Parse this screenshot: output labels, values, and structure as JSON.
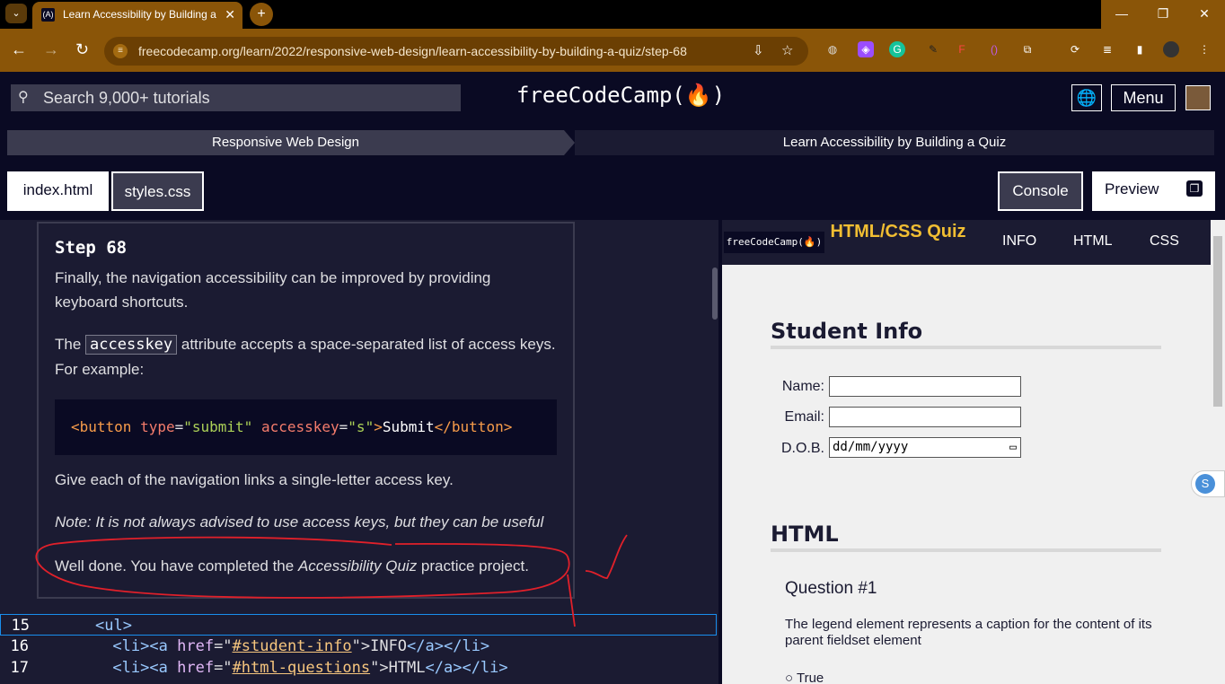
{
  "browser": {
    "tab_title": "Learn Accessibility by Building a",
    "tab_close": "✕",
    "new_tab": "+",
    "tab_favicon": "(A)",
    "url": "freecodecamp.org/learn/2022/responsive-web-design/learn-accessibility-by-building-a-quiz/step-68",
    "window_controls": {
      "minimize": "—",
      "restore": "❐",
      "close": "✕"
    },
    "back": "←",
    "forward": "→",
    "reload": "↻"
  },
  "fcc_nav": {
    "search_placeholder": "Search 9,000+ tutorials",
    "logo": "freeCodeCamp(🔥)",
    "menu_label": "Menu",
    "globe": "🌐"
  },
  "breadcrumb": {
    "superblock": "Responsive Web Design",
    "block": "Learn Accessibility by Building a Quiz"
  },
  "editor_tabs": [
    {
      "label": "index.html",
      "active": false
    },
    {
      "label": "styles.css",
      "active": true
    }
  ],
  "right_buttons": {
    "console": "Console",
    "preview": "Preview"
  },
  "instructions": {
    "step_title": "Step 68",
    "p1": "Finally, the navigation accessibility can be improved by providing keyboard shortcuts.",
    "p2_before": "The ",
    "p2_code": "accesskey",
    "p2_after": " attribute accepts a space-separated list of access keys. For example:",
    "example": {
      "open": "<",
      "tag": "button",
      "attr1": "type",
      "val1": "\"submit\"",
      "attr2": "accesskey",
      "val2": "\"s\"",
      "text": "Submit",
      "close_tag": "button",
      "eq": "=",
      "gt": ">",
      "closing_open": "</"
    },
    "p3": "Give each of the navigation links a single-letter access key.",
    "note": "Note: It is not always advised to use access keys, but they can be useful",
    "done_before": "Well done. You have completed the ",
    "done_em": "Accessibility Quiz",
    "done_after": " practice project."
  },
  "code_lines": [
    {
      "num": "15",
      "indent": "    ",
      "open": "<",
      "tag": "ul",
      "close": ">"
    },
    {
      "num": "16",
      "indent": "      ",
      "li_open": "<li><",
      "a": "a",
      "href": "href",
      "eq": "=\"",
      "link": "#student-info",
      "endq": "\">",
      "text": "INFO",
      "tail": "</a></li>"
    },
    {
      "num": "17",
      "indent": "      ",
      "li_open": "<li><",
      "a": "a",
      "href": "href",
      "eq": "=\"",
      "link": "#html-questions",
      "endq": "\">",
      "text": "HTML",
      "tail": "</a></li>"
    }
  ],
  "preview": {
    "logo": "freeCodeCamp(🔥)",
    "title": "HTML/CSS Quiz",
    "nav": [
      "INFO",
      "HTML",
      "CSS"
    ],
    "section1": "Student Info",
    "fields": [
      {
        "label": "Name:",
        "value": ""
      },
      {
        "label": "Email:",
        "value": ""
      },
      {
        "label": "D.O.B.",
        "value": "dd/mm/yyyy"
      }
    ],
    "section2": "HTML",
    "question": "Question #1",
    "question_text": "The legend element represents a caption for the content of its parent fieldset element",
    "option1": "True"
  },
  "colors": {
    "accent": "#f1be32",
    "bg": "#0a0a23",
    "panel": "#1b1b32",
    "annotation": "#e0202a"
  }
}
